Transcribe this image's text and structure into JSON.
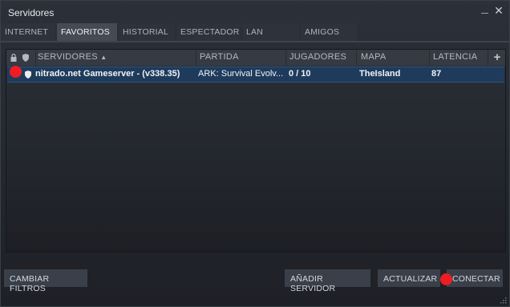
{
  "window": {
    "title": "Servidores"
  },
  "tabs": [
    {
      "label": "INTERNET",
      "active": false
    },
    {
      "label": "FAVORITOS",
      "active": true
    },
    {
      "label": "HISTORIAL",
      "active": false
    },
    {
      "label": "ESPECTADOR",
      "active": false
    },
    {
      "label": "LAN",
      "active": false
    },
    {
      "label": "AMIGOS",
      "active": false
    }
  ],
  "table": {
    "columns": {
      "servers": "SERVIDORES",
      "game": "PARTIDA",
      "players": "JUGADORES",
      "map": "MAPA",
      "latency": "LATENCIA"
    },
    "sort_indicator": "▲",
    "add_column": "+",
    "rows": [
      {
        "server": "nitrado.net Gameserver - (v338.35)",
        "game": "ARK: Survival Evolv...",
        "players": "0 / 10",
        "map": "TheIsland",
        "latency": "87",
        "selected": true
      }
    ]
  },
  "buttons": {
    "filters": "CAMBIAR FILTROS",
    "add_server": "AÑADIR SERVIDOR",
    "refresh": "ACTUALIZAR",
    "connect": "CONECTAR"
  },
  "icons": {
    "lock": "lock-icon",
    "shield": "shield-icon",
    "close": "close-icon",
    "minimize": "minimize-icon"
  },
  "colors": {
    "selected_row": "#1f3b5c",
    "active_tab": "#454b55",
    "marker": "#ee1c24"
  }
}
